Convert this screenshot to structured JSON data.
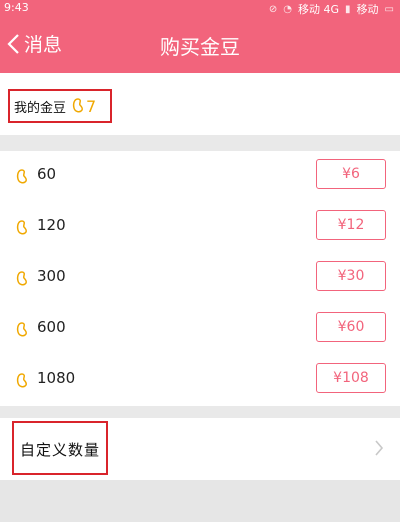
{
  "status_bar": {
    "time": "9:43",
    "signal_text_1": "移动 4G",
    "signal_text_2": "移动"
  },
  "navbar": {
    "back_label": "消息",
    "title": "购买金豆"
  },
  "balance": {
    "label": "我的金豆",
    "count": "7"
  },
  "packages": [
    {
      "amount": "60",
      "price": "¥6"
    },
    {
      "amount": "120",
      "price": "¥12"
    },
    {
      "amount": "300",
      "price": "¥30"
    },
    {
      "amount": "600",
      "price": "¥60"
    },
    {
      "amount": "1080",
      "price": "¥108"
    }
  ],
  "custom": {
    "label": "自定义数量"
  },
  "colors": {
    "brand": "#f2647c",
    "highlight_box": "#d9242b",
    "bean": "#f0a800"
  },
  "icons": {
    "back": "chevron-left-icon",
    "bean": "bean-icon",
    "row_arrow": "chevron-right-icon"
  }
}
